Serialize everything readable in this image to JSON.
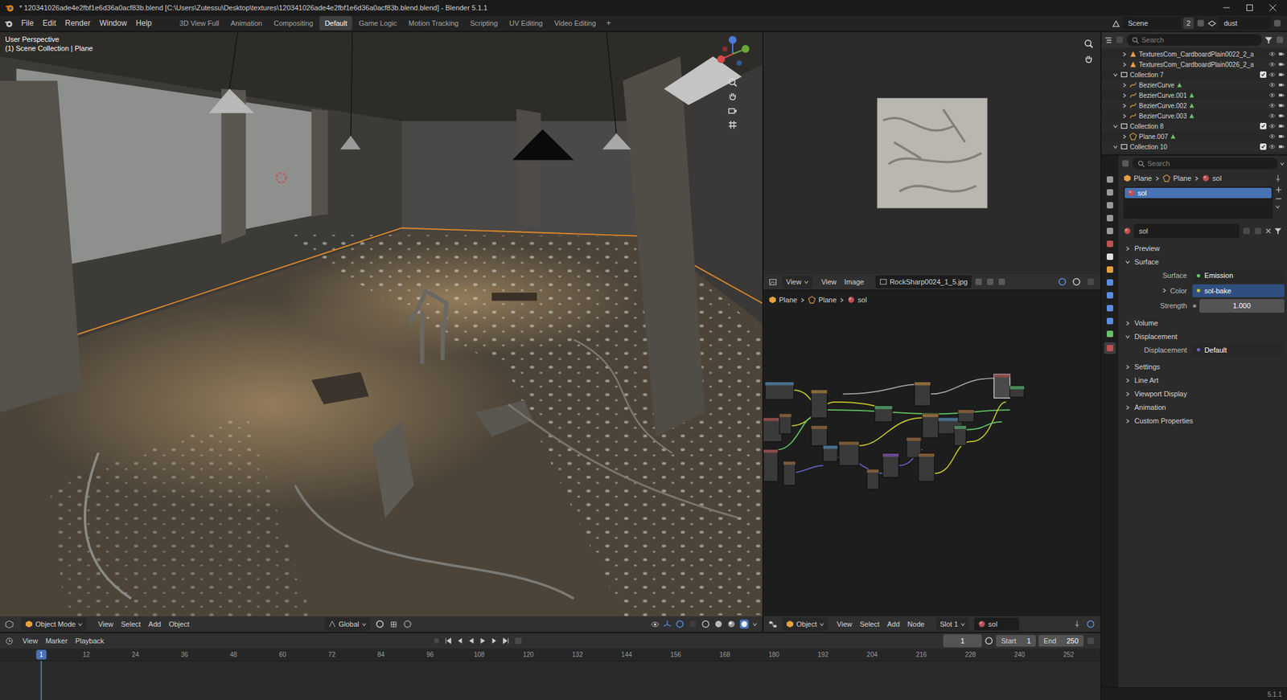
{
  "window": {
    "title": "* 120341026ade4e2fbf1e6d36a0acf83b.blend [C:\\Users\\Zutessu\\Desktop\\textures\\120341026ade4e2fbf1e6d36a0acf83b.blend.blend] - Blender 5.1.1"
  },
  "menu": [
    "File",
    "Edit",
    "Render",
    "Window",
    "Help"
  ],
  "workspaces": [
    {
      "label": "3D View Full",
      "selected": false
    },
    {
      "label": "Animation",
      "selected": false
    },
    {
      "label": "Compositing",
      "selected": false
    },
    {
      "label": "Default",
      "selected": true
    },
    {
      "label": "Game Logic",
      "selected": false
    },
    {
      "label": "Motion Tracking",
      "selected": false
    },
    {
      "label": "Scripting",
      "selected": false
    },
    {
      "label": "UV Editing",
      "selected": false
    },
    {
      "label": "Video Editing",
      "selected": false
    }
  ],
  "workspace_add": "+",
  "scene": {
    "name": "Scene",
    "users": "2",
    "view_layer": "dust"
  },
  "viewport": {
    "perspective": "User Perspective",
    "context": "(1) Scene Collection | Plane",
    "mode": "Object Mode",
    "menus": [
      "View",
      "Select",
      "Add",
      "Object"
    ],
    "orientation": "Global"
  },
  "image_editor": {
    "menus": [
      "View",
      "View",
      "Image"
    ],
    "image": "RockSharp0024_1_5.jpg"
  },
  "node_editor": {
    "breadcrumb": [
      "Plane",
      "Plane",
      "sol"
    ],
    "mode": "Object",
    "menus": [
      "View",
      "Select",
      "Add",
      "Node"
    ],
    "slot": "Slot 1",
    "material": "sol"
  },
  "timeline": {
    "menus": [
      "View",
      "Marker",
      "Playback"
    ],
    "current_frame": "1",
    "start_label": "Start",
    "start": "1",
    "end_label": "End",
    "end": "250",
    "ruler": [
      {
        "label": "1",
        "selected": true
      },
      {
        "label": "12",
        "selected": false
      },
      {
        "label": "24",
        "selected": false
      },
      {
        "label": "36",
        "selected": false
      },
      {
        "label": "48",
        "selected": false
      },
      {
        "label": "60",
        "selected": false
      },
      {
        "label": "72",
        "selected": false
      },
      {
        "label": "84",
        "selected": false
      },
      {
        "label": "96",
        "selected": false
      },
      {
        "label": "108",
        "selected": false
      },
      {
        "label": "120",
        "selected": false
      },
      {
        "label": "132",
        "selected": false
      },
      {
        "label": "144",
        "selected": false
      },
      {
        "label": "156",
        "selected": false
      },
      {
        "label": "168",
        "selected": false
      },
      {
        "label": "180",
        "selected": false
      },
      {
        "label": "192",
        "selected": false
      },
      {
        "label": "204",
        "selected": false
      },
      {
        "label": "216",
        "selected": false
      },
      {
        "label": "228",
        "selected": false
      },
      {
        "label": "240",
        "selected": false
      },
      {
        "label": "252",
        "selected": false
      }
    ]
  },
  "outliner": {
    "search": {
      "placeholder": "Search"
    },
    "items": [
      {
        "label": "TexturesCom_CardboardPlain0022_2_a",
        "kind": "image",
        "expanded": false
      },
      {
        "label": "TexturesCom_CardboardPlain0026_2_a",
        "kind": "image",
        "expanded": false
      },
      {
        "label": "Collection 7",
        "kind": "collection",
        "expanded": true,
        "checked": true
      },
      {
        "label": "BezierCurve",
        "kind": "curve",
        "expanded": false
      },
      {
        "label": "BezierCurve.001",
        "kind": "curve",
        "expanded": false
      },
      {
        "label": "BezierCurve.002",
        "kind": "curve",
        "expanded": false
      },
      {
        "label": "BezierCurve.003",
        "kind": "curve",
        "expanded": false
      },
      {
        "label": "Collection 8",
        "kind": "collection",
        "expanded": true,
        "checked": true
      },
      {
        "label": "Plane.007",
        "kind": "mesh",
        "expanded": false
      },
      {
        "label": "Collection 10",
        "kind": "collection",
        "expanded": true,
        "checked": true
      }
    ]
  },
  "properties": {
    "search": {
      "placeholder": "Search"
    },
    "breadcrumb": [
      "Plane",
      "Plane",
      "sol"
    ],
    "slots": [
      {
        "label": "sol",
        "selected": true
      }
    ],
    "material": "sol",
    "sections": [
      {
        "title": "Preview",
        "expanded": false,
        "fields": []
      },
      {
        "title": "Surface",
        "expanded": true,
        "fields": [
          {
            "label": "Surface",
            "value": "Emission",
            "kind": "link",
            "selected": false
          },
          {
            "label": "Color",
            "value": "sol-bake",
            "kind": "link",
            "selected": true
          },
          {
            "label": "Strength",
            "value": "1.000",
            "kind": "number",
            "selected": false
          }
        ]
      },
      {
        "title": "Volume",
        "expanded": false,
        "fields": []
      },
      {
        "title": "Displacement",
        "expanded": true,
        "fields": [
          {
            "label": "Displacement",
            "value": "Default",
            "kind": "link",
            "selected": false
          }
        ]
      },
      {
        "title": "Settings",
        "expanded": false,
        "fields": []
      },
      {
        "title": "Line Art",
        "expanded": false,
        "fields": []
      },
      {
        "title": "Viewport Display",
        "expanded": false,
        "fields": []
      },
      {
        "title": "Animation",
        "expanded": false,
        "fields": []
      },
      {
        "title": "Custom Properties",
        "expanded": false,
        "fields": []
      }
    ]
  },
  "status": {
    "version": "5.1.1"
  }
}
